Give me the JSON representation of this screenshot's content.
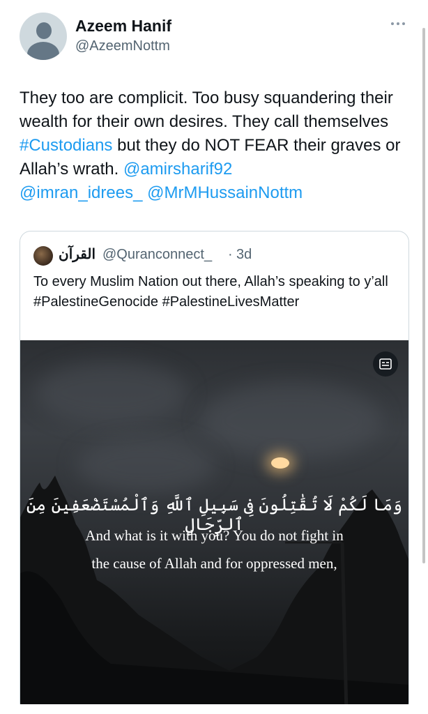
{
  "author": {
    "name": "Azeem Hanif",
    "handle": "@AzeemNottm"
  },
  "tweet": {
    "t1": "They too are complicit. Too busy squandering their wealth for their own desires. They call themselves ",
    "tag1": "#Custodians",
    "t2": " but they do NOT FEAR their graves or Allah’s wrath. ",
    "m1": "@amirsharif92",
    "m2": "@imran_idrees_",
    "m3": "@MrMHussainNottm"
  },
  "quote": {
    "name": "القرآن",
    "handle": "@Quranconnect_",
    "separator": "·",
    "time": "3d",
    "text": "To every Muslim Nation out there, Allah’s speaking to y’all #PalestineGenocide #PalestineLivesMatter",
    "media": {
      "arabic": "وَمَا لَكُمْ لَا تُقَٰتِلُونَ فِى سَبِيلِ ٱللَّهِ وَٱلْمُسْتَضْعَفِينَ مِنَ ٱلرِّجَالِ",
      "line1": "And what is it with you? You do not fight in",
      "line2": "the cause of Allah and for oppressed men,"
    }
  },
  "icons": {
    "more": "more-dots-icon",
    "media_action": "caption-icon"
  },
  "colors": {
    "accent": "#1d9bf0",
    "text": "#0f1419",
    "muted": "#536471"
  }
}
